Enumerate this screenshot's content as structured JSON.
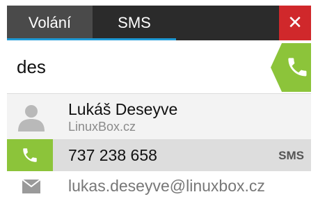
{
  "tabs": {
    "calls": "Volání",
    "sms": "SMS"
  },
  "close_glyph": "✕",
  "search": {
    "value": "des"
  },
  "contact": {
    "name": "Lukáš Deseyve",
    "org": "LinuxBox.cz",
    "phone": "737 238 658",
    "sms_label": "SMS",
    "email": "lukas.deseyve@linuxbox.cz"
  },
  "icons": {
    "call": "phone-icon",
    "avatar": "person-icon",
    "email": "envelope-icon",
    "close": "close-icon"
  },
  "colors": {
    "accent_green": "#8cc43a",
    "tab_underline": "#1e9ad6",
    "close_red": "#d0282b",
    "tabbar_bg": "#2b2b2b"
  }
}
